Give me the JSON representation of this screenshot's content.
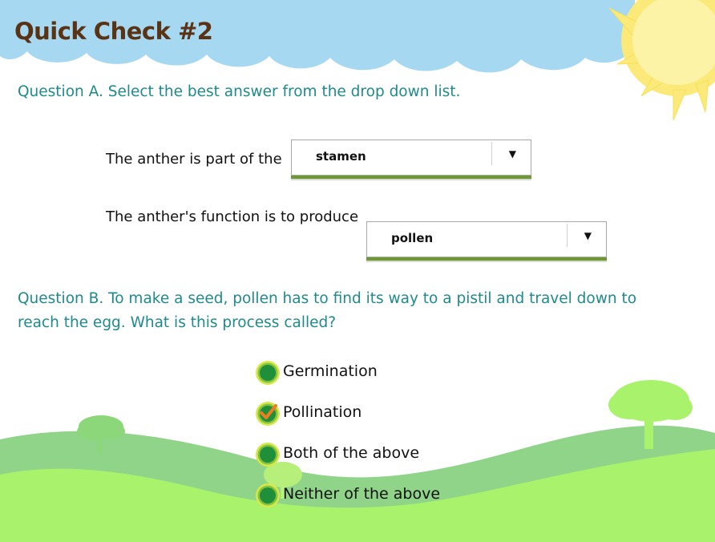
{
  "header": {
    "title": "Quick Check #2"
  },
  "question_a": {
    "prompt": "Question A. Select the best answer from the drop down list.",
    "items": [
      {
        "statement": "The anther is part of the",
        "selected": "stamen"
      },
      {
        "statement": "The anther's function is to produce",
        "selected": "pollen"
      }
    ]
  },
  "question_b": {
    "prompt": "Question B. To make a seed, pollen has to find its way to a pistil and travel down to reach the egg. What is this process called?",
    "options": [
      {
        "label": "Germination",
        "checked": false
      },
      {
        "label": "Pollination",
        "checked": true
      },
      {
        "label": "Both of the above",
        "checked": false
      },
      {
        "label": "Neither of the above",
        "checked": false
      }
    ]
  },
  "icons": {
    "radio": "sunflower-radio-icon",
    "check": "checkmark-icon",
    "dropdown": "triangle-down-icon"
  },
  "colors": {
    "title": "#5a3315",
    "question_text": "#1f8a8a",
    "sky_cloud": "#a6d8f1",
    "sun": "#fbe97a",
    "grass": "#a8f36b",
    "hill": "#8fd488",
    "radio_green": "#1f8f3a",
    "check_orange": "#f07c22"
  }
}
